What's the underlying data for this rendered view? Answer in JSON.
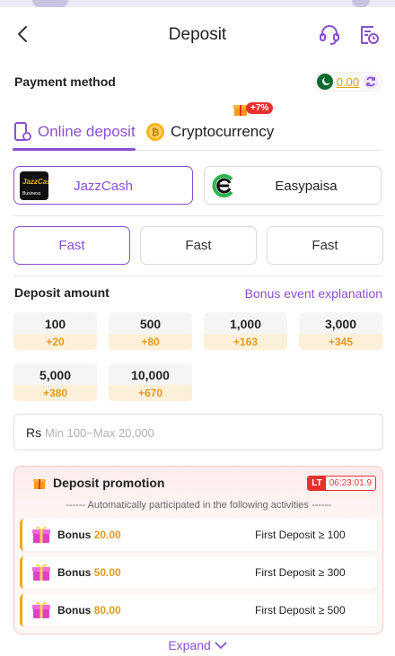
{
  "header": {
    "title": "Deposit"
  },
  "payment": {
    "label": "Payment method",
    "balance": "0.00"
  },
  "tabs": [
    {
      "label": "Online deposit",
      "active": true
    },
    {
      "label": "Cryptocurrency",
      "active": false,
      "badge": "+7%"
    }
  ],
  "methods": [
    {
      "name": "JazzCash",
      "active": true,
      "logo_text": "JazzCash",
      "logo_sub": "Business"
    },
    {
      "name": "Easypaisa",
      "active": false
    }
  ],
  "speeds": [
    {
      "label": "Fast",
      "active": true
    },
    {
      "label": "Fast",
      "active": false
    },
    {
      "label": "Fast",
      "active": false
    }
  ],
  "deposit": {
    "label": "Deposit amount",
    "bonus_link": "Bonus event explanation",
    "amounts": [
      {
        "value": "100",
        "bonus": "+20"
      },
      {
        "value": "500",
        "bonus": "+80"
      },
      {
        "value": "1,000",
        "bonus": "+163"
      },
      {
        "value": "3,000",
        "bonus": "+345"
      },
      {
        "value": "5,000",
        "bonus": "+380"
      },
      {
        "value": "10,000",
        "bonus": "+670"
      }
    ],
    "currency": "Rs",
    "placeholder": "Min 100~Max 20,000"
  },
  "promotion": {
    "title": "Deposit promotion",
    "timer_tag": "LT",
    "timer": "06:23:01.9",
    "subtitle": "------ Automatically participated in the following activities ------",
    "rows": [
      {
        "label": "Bonus",
        "amount": "20.00",
        "condition": "First Deposit ≥ 100"
      },
      {
        "label": "Bonus",
        "amount": "50.00",
        "condition": "First Deposit ≥ 300"
      },
      {
        "label": "Bonus",
        "amount": "80.00",
        "condition": "First Deposit ≥ 500"
      }
    ]
  },
  "expand_label": "Expand",
  "colors": {
    "accent": "#8a4fd0",
    "bonus": "#e39a1c",
    "alert": "#e8312e"
  }
}
